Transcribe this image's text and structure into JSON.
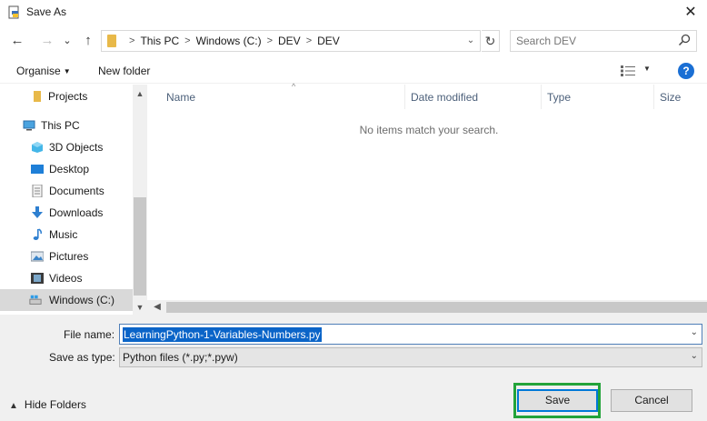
{
  "window": {
    "title": "Save As",
    "close_glyph": "✕"
  },
  "nav": {
    "back_glyph": "←",
    "forward_glyph": "→",
    "recent_glyph": "⌄",
    "up_glyph": "↑",
    "breadcrumbs": [
      "This PC",
      "Windows (C:)",
      "DEV",
      "DEV"
    ],
    "separator": ">",
    "refresh_glyph": "↻",
    "search_placeholder": "Search DEV"
  },
  "toolbar": {
    "organise_label": "Organise",
    "new_folder_label": "New folder",
    "help_label": "?"
  },
  "sidebar": {
    "items": [
      {
        "label": "Projects",
        "icon": "folder-icon"
      },
      {
        "label": "This PC",
        "icon": "computer-icon"
      },
      {
        "label": "3D Objects",
        "icon": "3d-objects-icon"
      },
      {
        "label": "Desktop",
        "icon": "desktop-icon"
      },
      {
        "label": "Documents",
        "icon": "documents-icon"
      },
      {
        "label": "Downloads",
        "icon": "downloads-icon"
      },
      {
        "label": "Music",
        "icon": "music-icon"
      },
      {
        "label": "Pictures",
        "icon": "pictures-icon"
      },
      {
        "label": "Videos",
        "icon": "videos-icon"
      },
      {
        "label": "Windows (C:)",
        "icon": "drive-icon",
        "selected": true
      }
    ]
  },
  "file_list": {
    "columns": [
      "Name",
      "Date modified",
      "Type",
      "Size"
    ],
    "empty_message": "No items match your search."
  },
  "form": {
    "file_name_label": "File name:",
    "file_name_value": "LearningPython-1-Variables-Numbers.py",
    "save_as_type_label": "Save as type:",
    "save_as_type_value": "Python files (*.py;*.pyw)"
  },
  "footer": {
    "hide_folders_label": "Hide Folders",
    "save_label": "Save",
    "cancel_label": "Cancel"
  },
  "colors": {
    "accent": "#0078d7",
    "help": "#1a6fd4",
    "highlight_border": "#23a33a",
    "selection": "#0a64c8"
  }
}
